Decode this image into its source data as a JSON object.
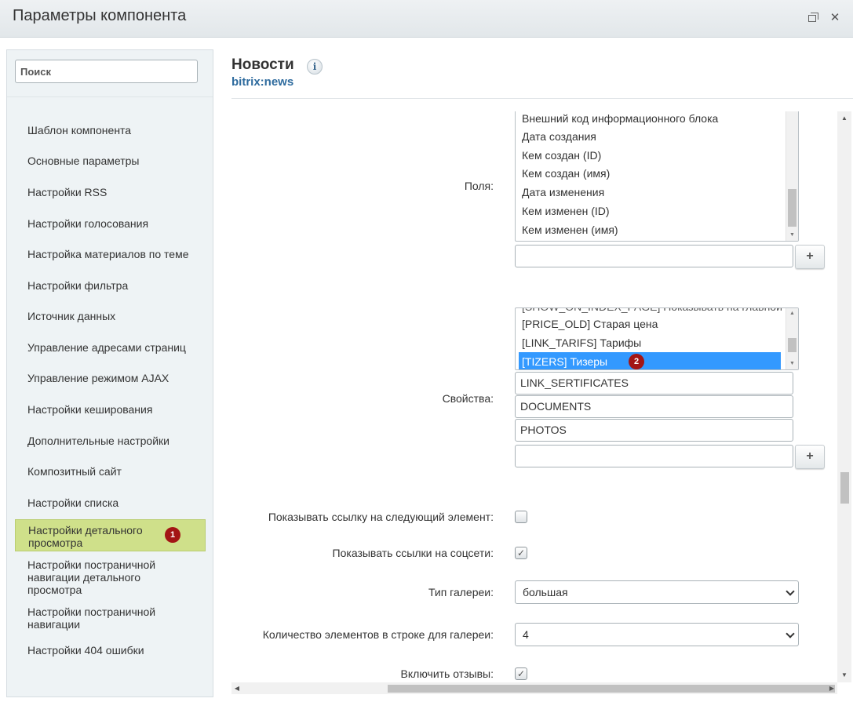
{
  "window": {
    "title": "Параметры компонента",
    "restore_icon": "restore-window-icon",
    "close_glyph": "✕"
  },
  "sidebar": {
    "search_placeholder": "Поиск",
    "items": [
      {
        "label": "Шаблон компонента"
      },
      {
        "label": "Основные параметры"
      },
      {
        "label": "Настройки RSS"
      },
      {
        "label": "Настройки голосования"
      },
      {
        "label": "Настройка материалов по теме"
      },
      {
        "label": "Настройки фильтра"
      },
      {
        "label": "Источник данных"
      },
      {
        "label": "Управление адресами страниц"
      },
      {
        "label": "Управление режимом AJAX"
      },
      {
        "label": "Настройки кеширования"
      },
      {
        "label": "Дополнительные настройки"
      },
      {
        "label": "Композитный сайт"
      },
      {
        "label": "Настройки списка"
      },
      {
        "label": "Настройки детального просмотра",
        "active": true,
        "badge": "1"
      },
      {
        "label": "Настройки постраничной навигации детального просмотра"
      },
      {
        "label": "Настройки постраничной навигации"
      },
      {
        "label": "Настройки 404 ошибки"
      }
    ]
  },
  "main": {
    "title": "Новости",
    "subtitle": "bitrix:news",
    "info_glyph": "i",
    "fields": {
      "label": "Поля:",
      "options": [
        "Внешний код информационного блока",
        "Дата создания",
        "Кем создан (ID)",
        "Кем создан (имя)",
        "Дата изменения",
        "Кем изменен (ID)",
        "Кем изменен (имя)"
      ],
      "extra_input_value": "",
      "add_label": "+"
    },
    "properties": {
      "label": "Свойства:",
      "options": [
        "[SHOW_ON_INDEX_PAGE] Показывать на главной",
        "[PRICE_OLD] Старая цена",
        "[LINK_TARIFS] Тарифы",
        "[TIZERS] Тизеры"
      ],
      "selected_badge": "2",
      "inputs": [
        "LINK_SERTIFICATES",
        "DOCUMENTS",
        "PHOTOS",
        ""
      ],
      "add_label": "+"
    },
    "show_next_link": {
      "label": "Показывать ссылку на следующий элемент:",
      "checked": false
    },
    "show_social": {
      "label": "Показывать ссылки на соцсети:",
      "checked": true
    },
    "gallery_type": {
      "label": "Тип галереи:",
      "value": "большая"
    },
    "gallery_count": {
      "label": "Количество элементов в строке для галереи:",
      "value": "4"
    },
    "reviews": {
      "label": "Включить отзывы:",
      "checked": true
    },
    "check_glyph": "✓"
  },
  "colors": {
    "active_item": "#cfe08a",
    "selected_option": "#3399ff",
    "badge": "#a31515",
    "subtitle": "#2e6b9e"
  }
}
